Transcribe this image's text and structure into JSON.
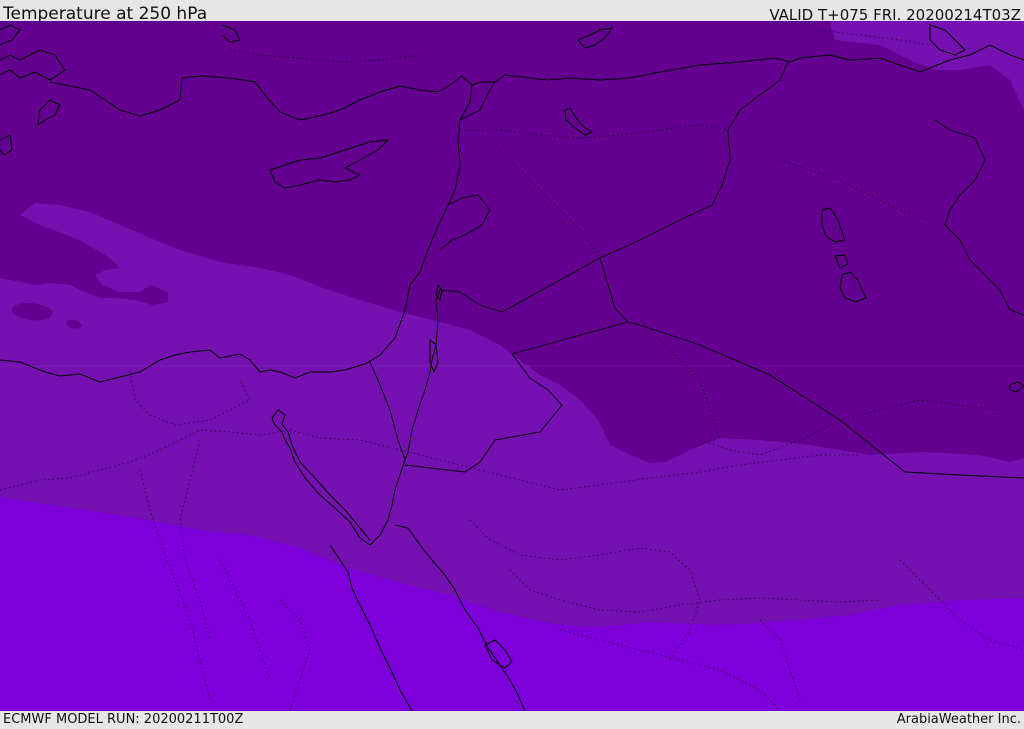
{
  "header": {
    "title": "Temperature at 250 hPa",
    "valid": "VALID T+075 FRI. 20200214T03Z"
  },
  "footer": {
    "model_run": "ECMWF MODEL RUN: 20200211T00Z",
    "credit": "ArabiaWeather Inc."
  },
  "map": {
    "fill_colors": {
      "coldest": "#63008f",
      "middle": "#7511b0",
      "warmest": "#7d00db"
    },
    "line_color": "#000000"
  }
}
